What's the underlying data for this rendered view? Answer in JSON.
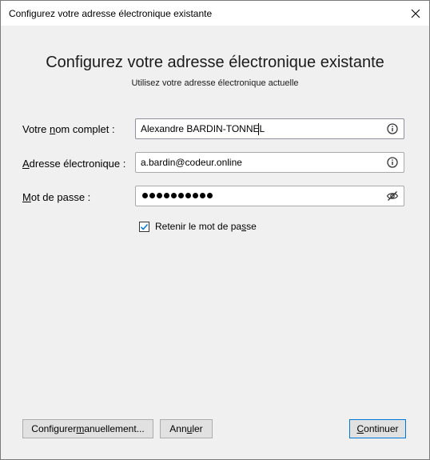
{
  "window": {
    "title": "Configurez votre adresse électronique existante"
  },
  "header": {
    "title": "Configurez votre adresse électronique existante",
    "subtitle": "Utilisez votre adresse électronique actuelle"
  },
  "form": {
    "name": {
      "label_pre": "Votre ",
      "label_key": "n",
      "label_post": "om complet :",
      "value": "Alexandre BARDIN-TONNEL"
    },
    "email": {
      "label_pre": "",
      "label_key": "A",
      "label_post": "dresse électronique :",
      "value": "a.bardin@codeur.online"
    },
    "password": {
      "label_pre": "",
      "label_key": "M",
      "label_post": "ot de passe :",
      "masked_count": 10
    },
    "remember": {
      "label_pre": "Retenir le mot de pa",
      "label_key": "s",
      "label_post": "se",
      "checked": true
    }
  },
  "buttons": {
    "manual": {
      "pre": "Configurer ",
      "key": "m",
      "post": "anuellement..."
    },
    "cancel": {
      "pre": "Ann",
      "key": "u",
      "post": "ler"
    },
    "continue": {
      "pre": "",
      "key": "C",
      "post": "ontinuer"
    }
  },
  "colors": {
    "accent": "#0078d7",
    "dialog_bg": "#f0f0f0"
  }
}
